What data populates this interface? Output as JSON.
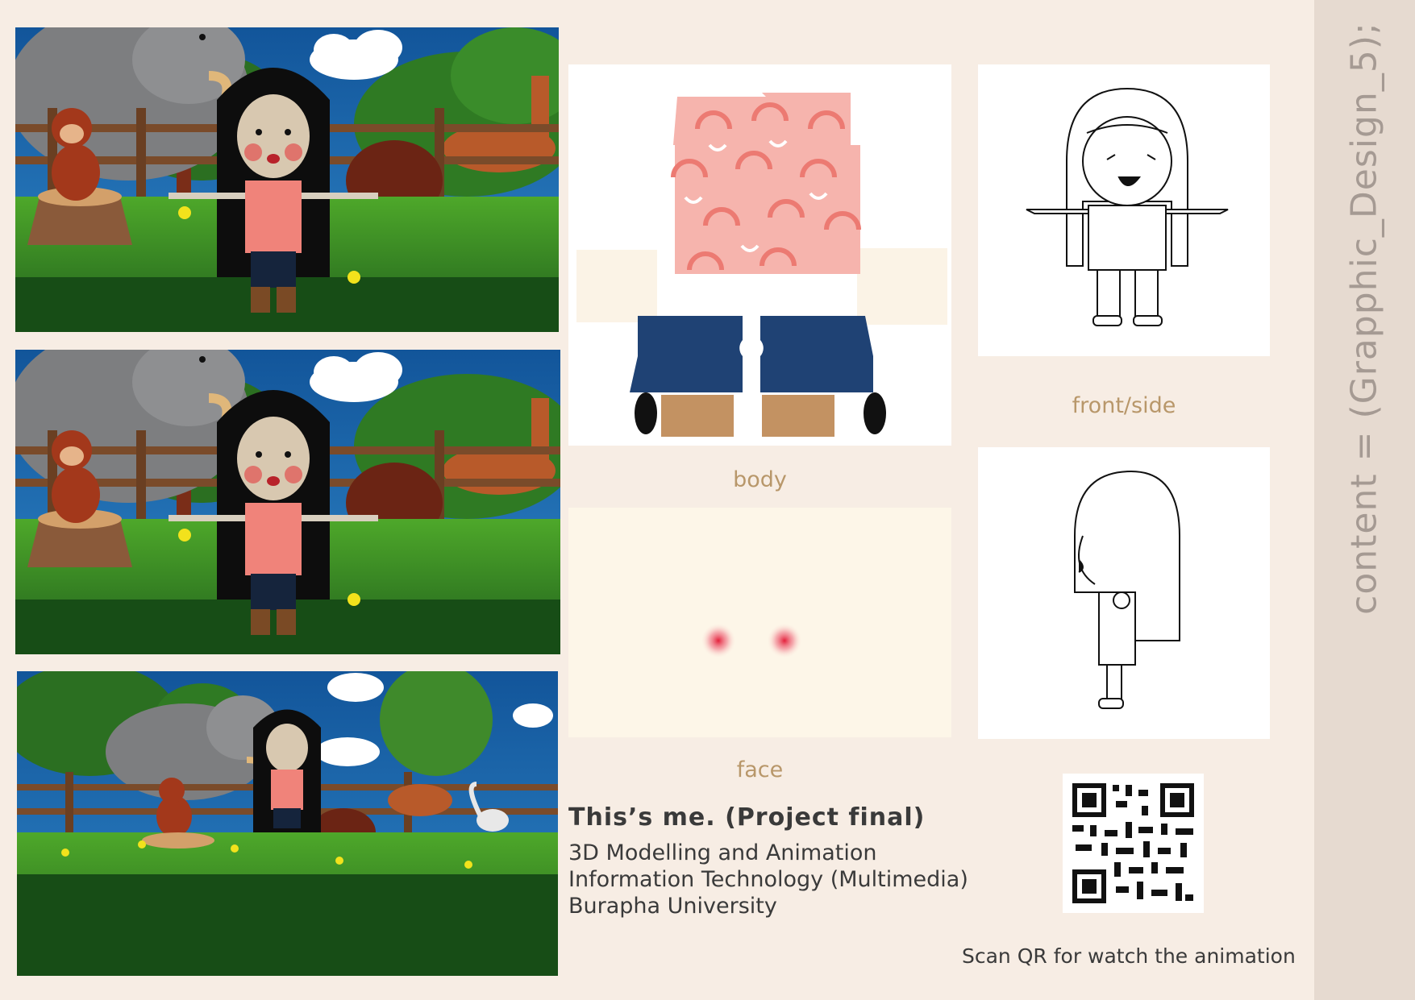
{
  "sidebar": {
    "text": "content = (Grapphic_Design_5);"
  },
  "labels": {
    "body": "body",
    "front_side": "front/side",
    "face": "face"
  },
  "project": {
    "title": "This’s me. (Project final)",
    "lines": [
      "3D Modelling and Animation",
      "Information Technology (Multimedia)",
      "Burapha University"
    ]
  },
  "qr": {
    "caption": "Scan QR for watch the animation"
  },
  "colors": {
    "background": "#f7ede4",
    "sidebar": "#e6dad0",
    "label": "#b8976a",
    "text": "#3a3a3a",
    "shirt": "#f6b4ad",
    "pants": "#1f4274"
  },
  "icons": [
    "monkey-icon",
    "elephant-icon",
    "deer-icon",
    "cloud-icon",
    "girl-character-icon",
    "qr-code-icon"
  ]
}
